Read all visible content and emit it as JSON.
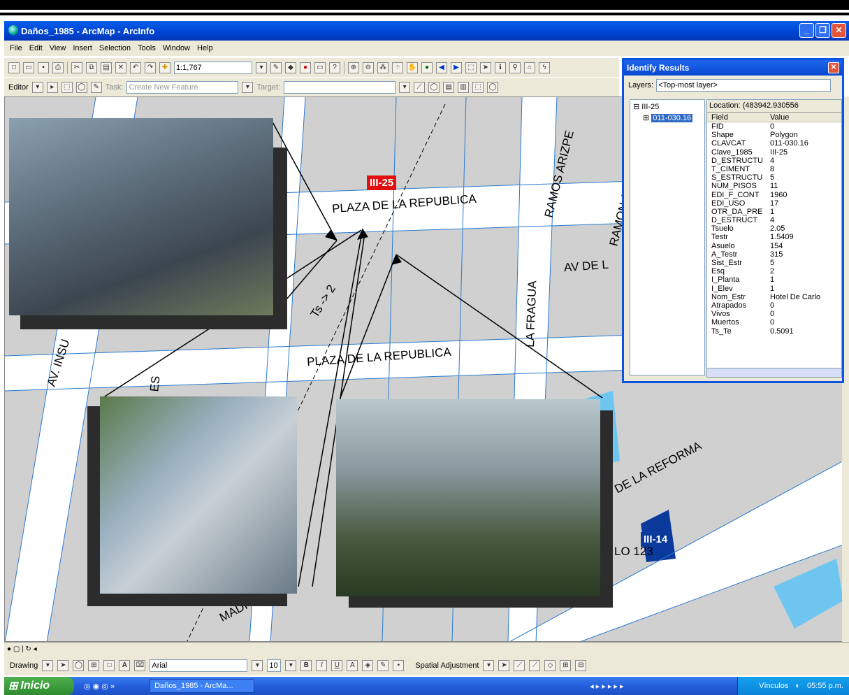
{
  "window": {
    "title": "Daños_1985 - ArcMap - ArcInfo"
  },
  "menu": [
    "File",
    "Edit",
    "View",
    "Insert",
    "Selection",
    "Tools",
    "Window",
    "Help"
  ],
  "toolbar": {
    "scale": "1:1,767",
    "editor_label": "Editor",
    "task_label": "Task:",
    "task_value": "Create New Feature",
    "target_label": "Target:"
  },
  "map": {
    "streets": [
      "PLAZA DE LA REPUBLICA",
      "PLAZA DE LA REPUBLICA",
      "RAMOS ARIZPE",
      "RAMON AL",
      "AV DE L",
      "LA FRAGUA",
      "AV. INSU",
      "DE LA REFORMA",
      "MADI",
      "ES",
      "LO 123"
    ],
    "annotation": "Ts -> 2",
    "badges": [
      {
        "text": "III-25",
        "color": "#e01010"
      },
      {
        "text": "III-14",
        "color": "#0a3a9c"
      }
    ]
  },
  "identify": {
    "title": "Identify Results",
    "layers_label": "Layers:",
    "layers_value": "<Top-most layer>",
    "tree_root": "III-25",
    "tree_child": "011-030.16",
    "location": "Location: (483942.930556",
    "headers": [
      "Field",
      "Value"
    ],
    "rows": [
      [
        "FID",
        "0"
      ],
      [
        "Shape",
        "Polygon"
      ],
      [
        "CLAVCAT",
        "011-030.16"
      ],
      [
        "Clave_1985",
        "III-25"
      ],
      [
        "D_ESTRUCTU",
        "4"
      ],
      [
        "T_CIMENT",
        "8"
      ],
      [
        "S_ESTRUCTU",
        "5"
      ],
      [
        "NUM_PISOS",
        "11"
      ],
      [
        "EDI_F_CONT",
        "1960"
      ],
      [
        "EDI_USO",
        "17"
      ],
      [
        "OTR_DA_PRE",
        "1"
      ],
      [
        "D_ESTRUCT",
        "4"
      ],
      [
        "Tsuelo",
        "2.05"
      ],
      [
        "Testr",
        "1.5409"
      ],
      [
        "Asuelo",
        "154"
      ],
      [
        "A_Testr",
        "315"
      ],
      [
        "Sist_Estr",
        "5"
      ],
      [
        "Esq",
        "2"
      ],
      [
        "I_Planta",
        "1"
      ],
      [
        "I_Elev",
        "1"
      ],
      [
        "Nom_Estr",
        "Hotel De Carlo"
      ],
      [
        "Atrapados",
        "0"
      ],
      [
        "Vivos",
        "0"
      ],
      [
        "Muertos",
        "0"
      ],
      [
        "Ts_Te",
        "0.5091"
      ]
    ]
  },
  "drawing": {
    "label": "Drawing",
    "font": "Arial",
    "size": "10",
    "spatial": "Spatial Adjustment"
  },
  "taskbar": {
    "start": "Inicio",
    "task": "Daños_1985 - ArcMa...",
    "links": "Vínculos",
    "time": "05:55 p.m."
  }
}
